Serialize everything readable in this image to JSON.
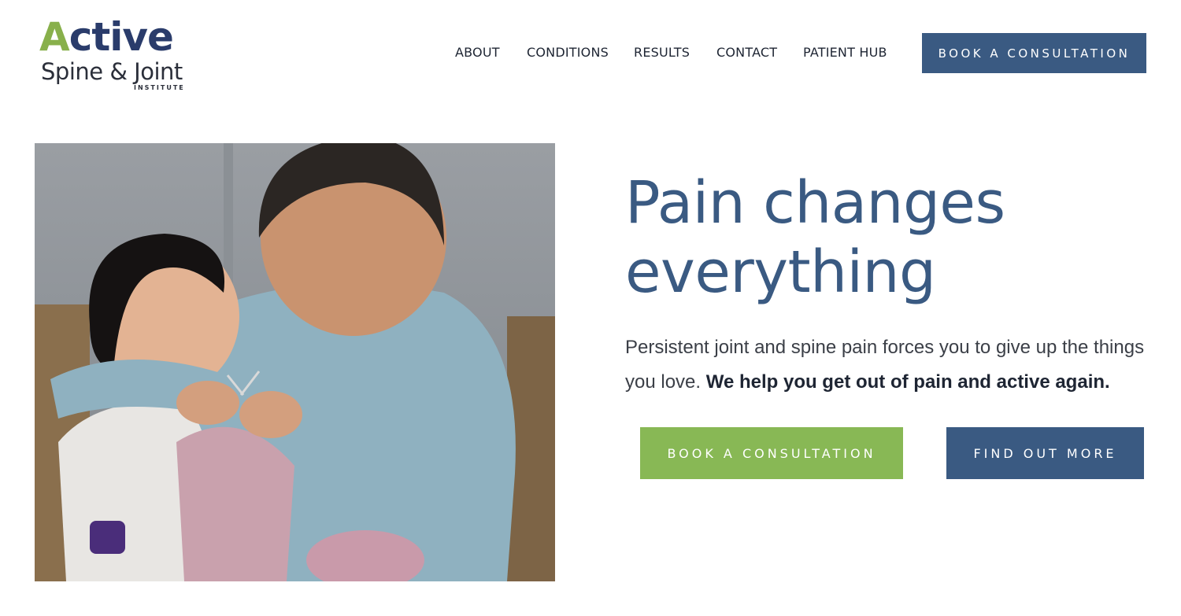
{
  "brand": {
    "logo_word": "ctive",
    "logo_initial": "A",
    "logo_subtitle": "Spine & Joint",
    "logo_tagline": "INSTITUTE",
    "colors": {
      "navy": "#3a5a82",
      "green": "#88b855",
      "logo_navy": "#2a3c6b",
      "logo_green": "#88b04b"
    }
  },
  "nav": {
    "items": [
      {
        "label": "ABOUT"
      },
      {
        "label": "CONDITIONS"
      },
      {
        "label": "RESULTS"
      },
      {
        "label": "CONTACT"
      },
      {
        "label": "PATIENT HUB"
      }
    ],
    "cta_label": "BOOK A CONSULTATION"
  },
  "hero": {
    "image_icon": "photo-grandmother-child-knitting",
    "headline_line1": "Pain changes",
    "headline_line2": "everything",
    "body_plain": "Persistent joint and spine pain forces you to give up the things you love. ",
    "body_bold": "We help you get out of pain and active again.",
    "primary_cta": "BOOK A CONSULTATION",
    "secondary_cta": "FIND OUT MORE"
  }
}
